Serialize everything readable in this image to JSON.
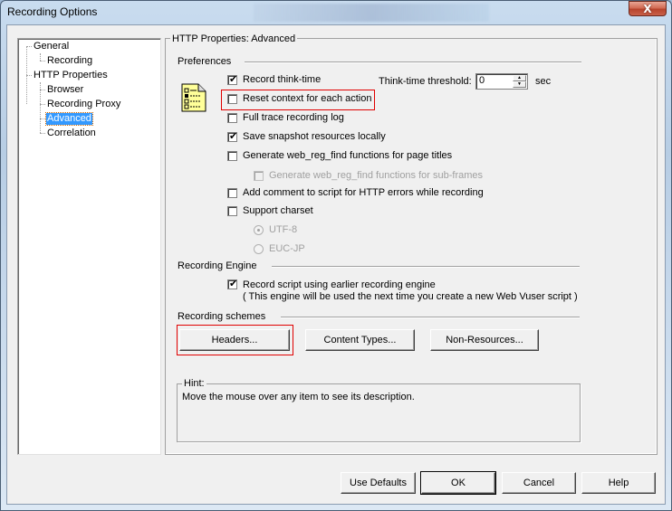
{
  "window": {
    "title": "Recording Options",
    "close_glyph": "X"
  },
  "tree": {
    "items": [
      {
        "label": "General",
        "level": 0
      },
      {
        "label": "Recording",
        "level": 1
      },
      {
        "label": "HTTP Properties",
        "level": 0
      },
      {
        "label": "Browser",
        "level": 1
      },
      {
        "label": "Recording Proxy",
        "level": 1
      },
      {
        "label": "Advanced",
        "level": 1,
        "selected": true
      },
      {
        "label": "Correlation",
        "level": 1
      }
    ]
  },
  "panel": {
    "title": "HTTP Properties: Advanced",
    "preferences": {
      "heading": "Preferences",
      "icon": "checklist-document-icon",
      "options": [
        {
          "label": "Record think-time",
          "checked": true,
          "enabled": true,
          "mnemonic": "e"
        },
        {
          "label": "Reset context for each action",
          "checked": false,
          "enabled": true,
          "mnemonic": "R",
          "highlighted": true
        },
        {
          "label": "Full trace recording log",
          "checked": false,
          "enabled": true
        },
        {
          "label": "Save snapshot resources locally",
          "checked": true,
          "enabled": true,
          "mnemonic": "S"
        },
        {
          "label": "Generate web_reg_find functions for page titles",
          "checked": false,
          "enabled": true,
          "mnemonic": "G"
        },
        {
          "label": "Generate web_reg_find functions for sub-frames",
          "checked": false,
          "enabled": false,
          "mnemonic": "w"
        },
        {
          "label": "Add comment to script for HTTP errors while recording",
          "checked": false,
          "enabled": true,
          "mnemonic": "A"
        },
        {
          "label": "Support charset",
          "checked": false,
          "enabled": true,
          "mnemonic": "p"
        }
      ],
      "charsets": [
        {
          "label": "UTF-8",
          "selected": true,
          "enabled": false
        },
        {
          "label": "EUC-JP",
          "selected": false,
          "enabled": false
        }
      ],
      "think_time_threshold": {
        "label": "Think-time threshold:",
        "value": "0",
        "unit": "sec"
      }
    },
    "engine": {
      "heading": "Recording Engine",
      "option_label": "Record script using earlier recording engine",
      "option_checked": true,
      "note": "( This engine will be used the next time you create a new Web Vuser script )"
    },
    "schemes": {
      "heading": "Recording schemes",
      "buttons": [
        "Headers...",
        "Content Types...",
        "Non-Resources..."
      ]
    },
    "hint": {
      "label": "Hint:",
      "text": "Move the mouse over any item to see its description."
    }
  },
  "footer": {
    "buttons": [
      "Use Defaults",
      "OK",
      "Cancel",
      "Help"
    ]
  },
  "colors": {
    "selection": "#3399ff",
    "highlight_box": "#e00000",
    "dialog_bg": "#f0f0f0"
  }
}
